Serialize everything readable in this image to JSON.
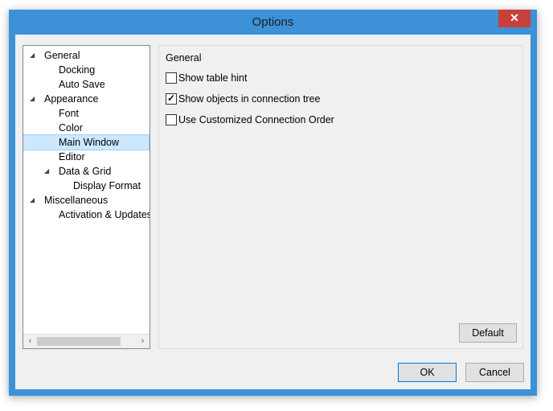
{
  "window": {
    "title": "Options",
    "close_glyph": "✕"
  },
  "tree": {
    "items": [
      {
        "label": "General",
        "expanded": true
      },
      {
        "label": "Docking"
      },
      {
        "label": "Auto Save"
      },
      {
        "label": "Appearance",
        "expanded": true
      },
      {
        "label": "Font"
      },
      {
        "label": "Color"
      },
      {
        "label": "Main Window",
        "selected": true
      },
      {
        "label": "Editor"
      },
      {
        "label": "Data & Grid",
        "expanded": true
      },
      {
        "label": "Display Format"
      },
      {
        "label": "Miscellaneous",
        "expanded": true
      },
      {
        "label": "Activation & Updates"
      }
    ],
    "expand_glyph": "◢",
    "scroll_left": "‹",
    "scroll_right": "›"
  },
  "panel": {
    "group_title": "General",
    "options": [
      {
        "label": "Show table hint",
        "checked": false
      },
      {
        "label": "Show objects in connection tree",
        "checked": true
      },
      {
        "label": "Use Customized Connection Order",
        "checked": false
      }
    ],
    "check_glyph": "✓",
    "default_button": "Default"
  },
  "buttons": {
    "ok": "OK",
    "cancel": "Cancel"
  }
}
